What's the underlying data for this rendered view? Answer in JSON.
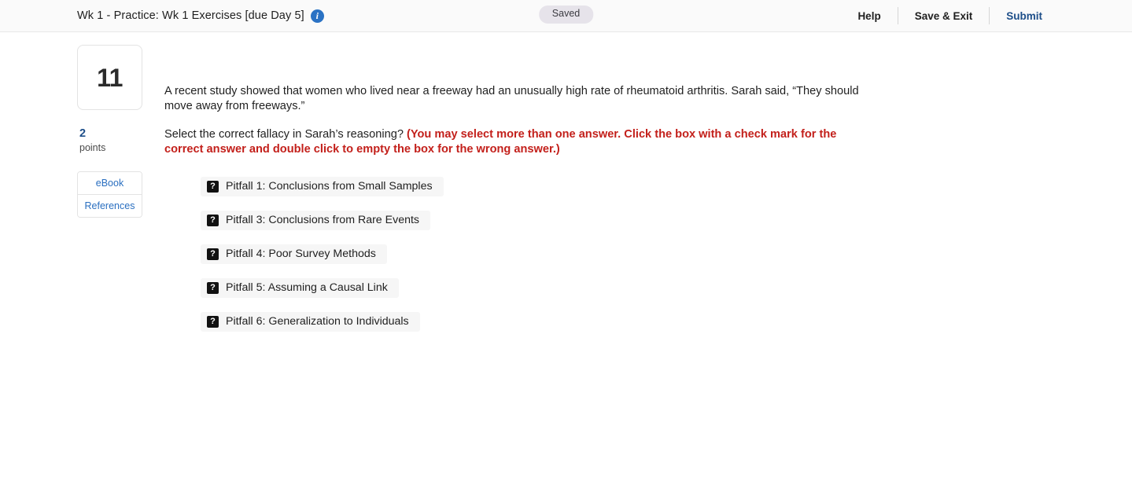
{
  "header": {
    "title": "Wk 1 - Practice: Wk 1 Exercises [due Day 5]",
    "info_icon": "info-circle-icon",
    "status_badge": "Saved",
    "actions": [
      {
        "label": "Help",
        "style": "default"
      },
      {
        "label": "Save & Exit",
        "style": "default"
      },
      {
        "label": "Submit",
        "style": "primary"
      }
    ]
  },
  "question": {
    "number": "11",
    "points_value": "2",
    "points_label": "points",
    "resources": [
      {
        "label": "eBook"
      },
      {
        "label": "References"
      }
    ],
    "stem": "A recent study showed that women who lived near a freeway had an unusually high rate of rheumatoid arthritis. Sarah said, “They should move away from freeways.”",
    "prompt_plain": "Select the correct fallacy in Sarah’s reasoning? ",
    "prompt_emphasis": "(You may select more than one answer. Click the box with a check mark for the correct answer and double click to empty the box for the wrong answer.)",
    "options": [
      {
        "icon": "broken-image-icon",
        "label": "Pitfall 1: Conclusions from Small Samples"
      },
      {
        "icon": "broken-image-icon",
        "label": "Pitfall 3: Conclusions from Rare Events"
      },
      {
        "icon": "broken-image-icon",
        "label": "Pitfall 4: Poor Survey Methods"
      },
      {
        "icon": "broken-image-icon",
        "label": "Pitfall 5: Assuming a Causal Link"
      },
      {
        "icon": "broken-image-icon",
        "label": "Pitfall 6: Generalization to Individuals"
      }
    ],
    "option_icon_glyph": "?"
  },
  "colors": {
    "link_blue": "#2a6fc0",
    "primary_blue": "#1d4e89",
    "emphasis_red": "#c3201b",
    "badge_bg": "#e6e3ea",
    "option_bg": "#f6f6f6"
  }
}
